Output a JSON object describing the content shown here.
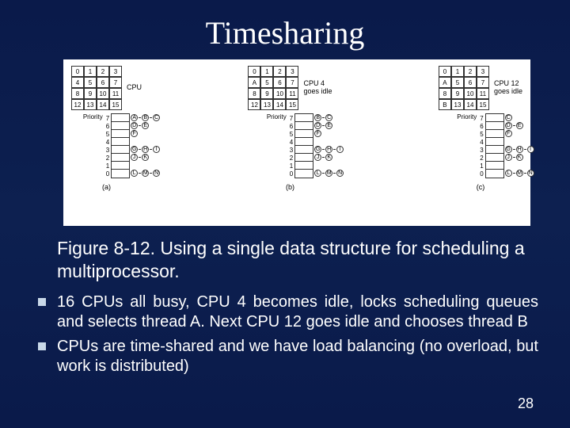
{
  "title": "Timesharing",
  "figure": {
    "panels": [
      {
        "grid": [
          "0",
          "1",
          "2",
          "3",
          "4",
          "5",
          "6",
          "7",
          "8",
          "9",
          "10",
          "11",
          "12",
          "13",
          "14",
          "15"
        ],
        "side_label": "CPU",
        "priority_word": "Priority",
        "priority_numbers": [
          "7",
          "6",
          "5",
          "4",
          "3",
          "2",
          "1",
          "0"
        ],
        "chains": {
          "7": [
            "A",
            "B",
            "C"
          ],
          "6": [
            "D",
            "E"
          ],
          "5": [
            "F"
          ],
          "3": [
            "G",
            "H",
            "I"
          ],
          "2": [
            "J",
            "K"
          ],
          "0": [
            "L",
            "M",
            "N"
          ]
        },
        "sub": "(a)"
      },
      {
        "grid": [
          "0",
          "1",
          "2",
          "3",
          "A",
          "5",
          "6",
          "7",
          "8",
          "9",
          "10",
          "11",
          "12",
          "13",
          "14",
          "15"
        ],
        "side_label": "CPU 4\ngoes idle",
        "priority_word": "Priority",
        "priority_numbers": [
          "7",
          "6",
          "5",
          "4",
          "3",
          "2",
          "1",
          "0"
        ],
        "chains": {
          "7": [
            "B",
            "C"
          ],
          "6": [
            "D",
            "E"
          ],
          "5": [
            "F"
          ],
          "3": [
            "G",
            "H",
            "I"
          ],
          "2": [
            "J",
            "K"
          ],
          "0": [
            "L",
            "M",
            "N"
          ]
        },
        "sub": "(b)"
      },
      {
        "grid": [
          "0",
          "1",
          "2",
          "3",
          "A",
          "5",
          "6",
          "7",
          "8",
          "9",
          "10",
          "11",
          "B",
          "13",
          "14",
          "15"
        ],
        "side_label": "CPU 12\ngoes idle",
        "priority_word": "Priority",
        "priority_numbers": [
          "7",
          "6",
          "5",
          "4",
          "3",
          "2",
          "1",
          "0"
        ],
        "chains": {
          "7": [
            "C"
          ],
          "6": [
            "D",
            "E"
          ],
          "5": [
            "F"
          ],
          "3": [
            "G",
            "H",
            "I"
          ],
          "2": [
            "J",
            "K"
          ],
          "0": [
            "L",
            "M",
            "N"
          ]
        },
        "sub": "(c)"
      }
    ]
  },
  "caption": "Figure 8-12. Using a single data structure for scheduling a multiprocessor.",
  "bullets": [
    "16 CPUs all busy, CPU 4 becomes idle, locks scheduling queues and selects thread A. Next CPU 12 goes idle and chooses thread B",
    "CPUs are time-shared and we have load balancing (no overload, but work is distributed)"
  ],
  "page_number": "28"
}
